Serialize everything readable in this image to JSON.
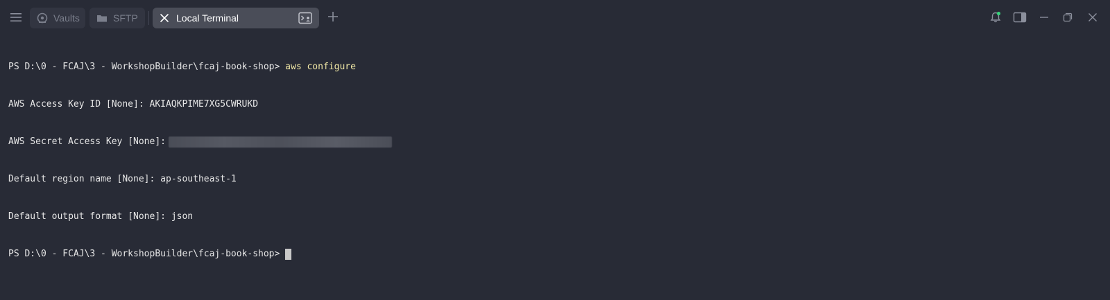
{
  "tabs": {
    "vaults": "Vaults",
    "sftp": "SFTP",
    "active": "Local Terminal"
  },
  "icons": {
    "menu": "hamburger-icon",
    "vaults": "vaults-icon",
    "sftp": "folder-icon",
    "close": "close-icon",
    "terminal": "terminal-icon",
    "new_tab": "plus-icon",
    "notifications": "bell-icon",
    "sidebar": "sidebar-toggle-icon",
    "minimize": "minimize-icon",
    "restore": "restore-icon",
    "close_window": "close-window-icon"
  },
  "colors": {
    "background": "#282b36",
    "active_tab": "#4a4d58",
    "inactive_tab": "#323541",
    "notification_dot": "#36d17a",
    "command_highlight": "#f1e8a6"
  },
  "terminal": {
    "prompt": "PS D:\\0 - FCAJ\\3 - WorkshopBuilder\\fcaj-book-shop> ",
    "command": "aws configure",
    "access_key_label": "AWS Access Key ID [None]: ",
    "access_key_value": "AKIAQKPIME7XG5CWRUKD",
    "secret_key_label": "AWS Secret Access Key [None]:",
    "region_label": "Default region name [None]: ",
    "region_value": "ap-southeast-1",
    "output_label": "Default output format [None]: ",
    "output_value": "json",
    "prompt2": "PS D:\\0 - FCAJ\\3 - WorkshopBuilder\\fcaj-book-shop>"
  }
}
